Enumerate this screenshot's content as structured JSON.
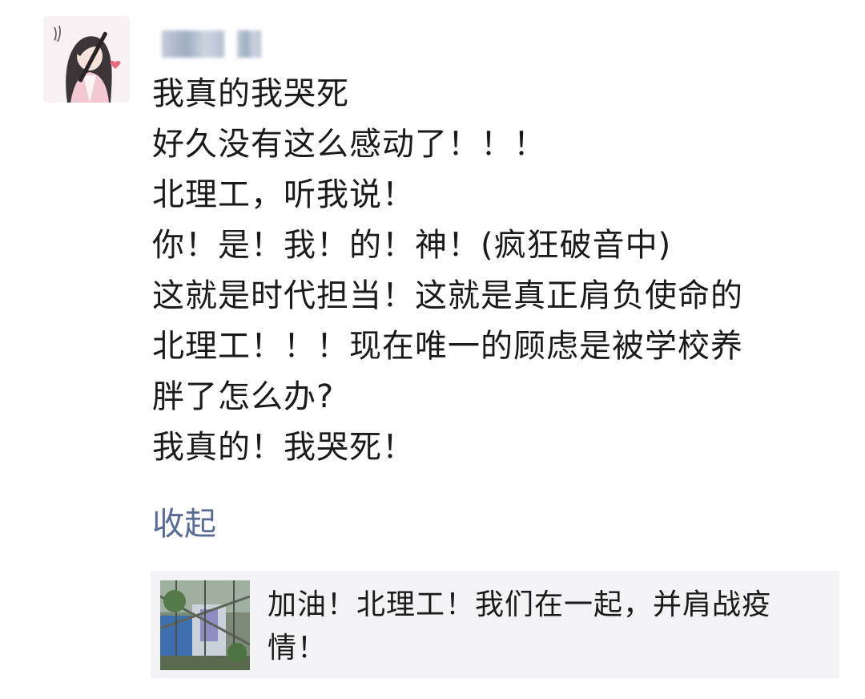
{
  "post": {
    "author_name": "",
    "lines": [
      "我真的我哭死",
      "好久没有这么感动了！！！",
      "北理工，听我说！",
      "你！是！我！的！神！(疯狂破音中)",
      "这就是时代担当！这就是真正肩负使命的",
      "北理工！！！现在唯一的顾虑是被学校养",
      "胖了怎么办?",
      "我真的！我哭死！"
    ],
    "collapse_label": "收起"
  },
  "shared_link": {
    "text_lines": [
      "加油！北理工！我们在一起，并肩战疫",
      "情！"
    ]
  },
  "colors": {
    "link": "#576b95",
    "card_bg": "#f3f3f5",
    "text": "#1a1a1a"
  }
}
